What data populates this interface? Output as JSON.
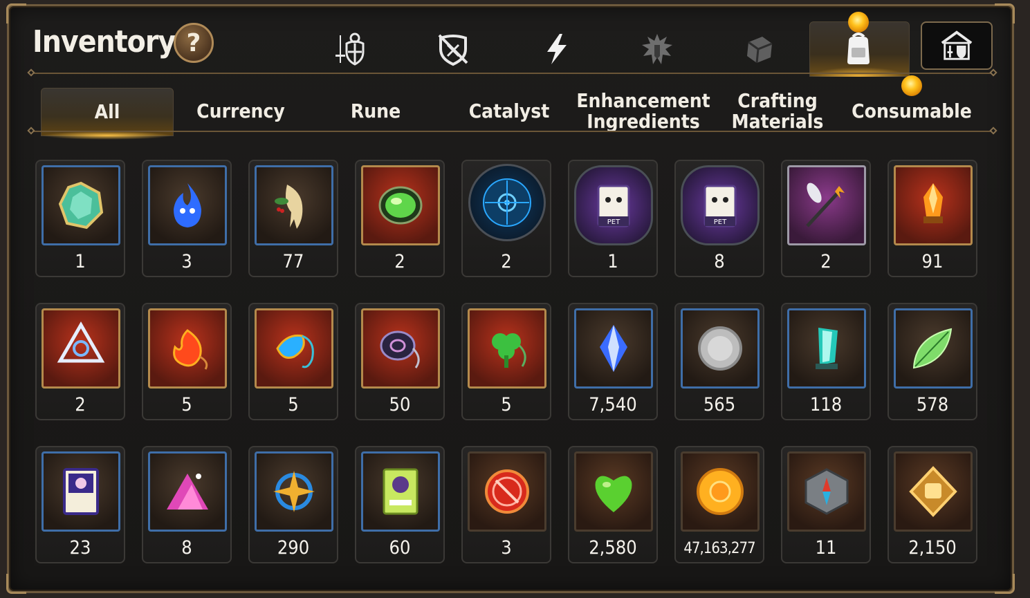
{
  "header": {
    "title": "Inventory",
    "help_label": "?"
  },
  "category_icons": [
    {
      "name": "weapons-armor-icon",
      "active": false
    },
    {
      "name": "crossed-shield-icon",
      "active": false
    },
    {
      "name": "lightning-icon",
      "active": false
    },
    {
      "name": "splash-badge-icon",
      "active": false
    },
    {
      "name": "dice-cube-icon",
      "active": false
    },
    {
      "name": "backpack-icon",
      "active": true,
      "notification": true
    }
  ],
  "guild_button": {
    "icon": "guild-house-icon"
  },
  "tabs": [
    {
      "label": "All",
      "active": true
    },
    {
      "label": "Currency",
      "active": false
    },
    {
      "label": "Rune",
      "active": false
    },
    {
      "label": "Catalyst",
      "active": false
    },
    {
      "label": "Enhancement\nIngredients",
      "active": false
    },
    {
      "label": "Crafting\nMaterials",
      "active": false
    },
    {
      "label": "Consumable",
      "active": false,
      "notification": true
    }
  ],
  "items": [
    {
      "icon": "green-gem-icon",
      "qty": "1"
    },
    {
      "icon": "blue-flame-icon",
      "qty": "3"
    },
    {
      "icon": "ginseng-root-icon",
      "qty": "77"
    },
    {
      "icon": "green-orb-icon",
      "qty": "2"
    },
    {
      "icon": "blue-rune-circle-icon",
      "qty": "2"
    },
    {
      "icon": "pet-food-bag-icon",
      "qty": "1"
    },
    {
      "icon": "pet-food-bag-icon",
      "qty": "8"
    },
    {
      "icon": "feather-duster-icon",
      "qty": "2"
    },
    {
      "icon": "orange-crystal-icon",
      "qty": "91"
    },
    {
      "icon": "triquetra-crystal-icon",
      "qty": "2"
    },
    {
      "icon": "fire-pendant-icon",
      "qty": "5"
    },
    {
      "icon": "water-pendant-icon",
      "qty": "5"
    },
    {
      "icon": "dark-pendant-icon",
      "qty": "50"
    },
    {
      "icon": "clover-pendant-icon",
      "qty": "5"
    },
    {
      "icon": "blue-crystal-icon",
      "qty": "7,540"
    },
    {
      "icon": "silver-coin-icon",
      "qty": "565"
    },
    {
      "icon": "teal-crystal-icon",
      "qty": "118"
    },
    {
      "icon": "green-leaf-icon",
      "qty": "578"
    },
    {
      "icon": "purple-card-icon",
      "qty": "23"
    },
    {
      "icon": "pink-crystal-pile-icon",
      "qty": "8"
    },
    {
      "icon": "star-pendant-icon",
      "qty": "290"
    },
    {
      "icon": "green-card-icon",
      "qty": "60"
    },
    {
      "icon": "red-badge-icon",
      "qty": "3"
    },
    {
      "icon": "green-heart-icon",
      "qty": "2,580"
    },
    {
      "icon": "gold-coin-icon",
      "qty": "47,163,277"
    },
    {
      "icon": "stone-compass-icon",
      "qty": "11"
    },
    {
      "icon": "fist-emblem-icon",
      "qty": "2,150"
    }
  ],
  "colors": {
    "panel_bg": "#1b1a19",
    "frame_blue": "#3f6ea8",
    "frame_gold": "#b48a4c",
    "accent_glow": "#ffc21d",
    "text": "#f5f2ec"
  }
}
